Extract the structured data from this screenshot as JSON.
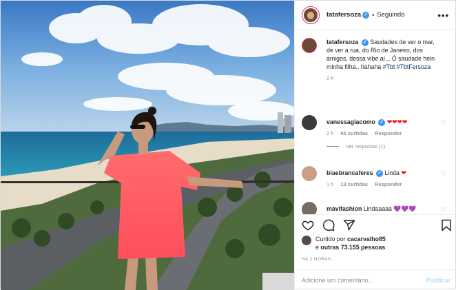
{
  "header": {
    "username": "tatafersoza",
    "separator": "•",
    "follow_status": "Seguindo",
    "more": "•••"
  },
  "caption": {
    "username": "tatafersoza",
    "text": "Saudades de ver o mar, de ver a rua, do Rio de Janeiro, dos amigos, dessa vibe aí... Ó saudade hein minha filha.. hahaha",
    "hashtag1": "#Tbt",
    "hashtag2": "#TbtFersoza",
    "age": "2 h"
  },
  "comments": [
    {
      "username": "vanessagiacomo",
      "text": "❤❤❤❤",
      "age": "2 h",
      "likes": "65 curtidas",
      "reply": "Responder",
      "view_replies": "Ver respostas (1)"
    },
    {
      "username": "biaebrancaferes",
      "text": "Linda",
      "emoji": "❤",
      "age": "1 h",
      "likes": "13 curtidas",
      "reply": "Responder"
    },
    {
      "username": "mavifashion",
      "text": "Lindaaaaa",
      "emoji": "💜💜💜"
    }
  ],
  "likes": {
    "prefix": "Curtido por",
    "user": "cacarvalho85",
    "and": "e",
    "others": "outras 73.155 pessoas"
  },
  "timestamp": "HÁ 2 HORAS",
  "add_comment": {
    "placeholder": "Adicione um comentário...",
    "publish": "Publicar"
  },
  "colors": {
    "verified": "#3897f0",
    "hashtag": "#003569",
    "heart": "#ed1c24",
    "publish_disabled": "#b2dffc"
  },
  "icons": [
    "verified-icon",
    "more-icon",
    "heart-icon",
    "comment-icon",
    "share-icon",
    "bookmark-icon"
  ]
}
